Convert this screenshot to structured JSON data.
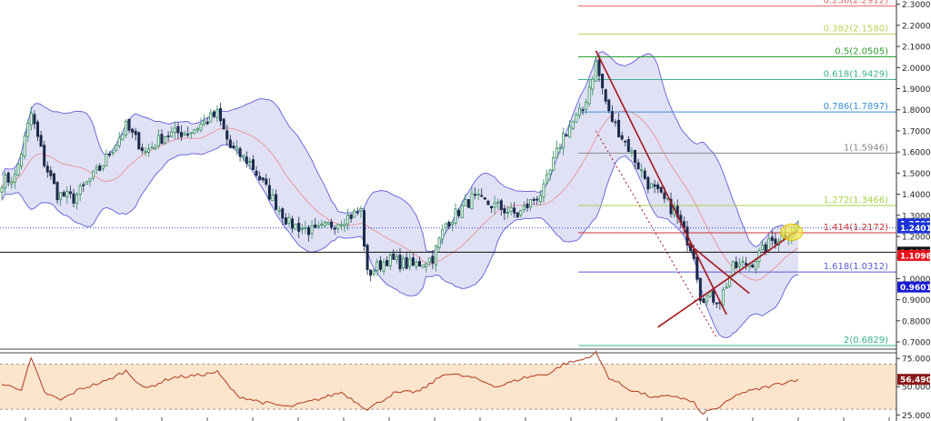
{
  "chart_data": [
    {
      "type": "candlestick",
      "panel": "price",
      "ylim": [
        0.67,
        2.32
      ],
      "y_ticks": [
        "2.3000",
        "2.2000",
        "2.1000",
        "2.0000",
        "1.9000",
        "1.8000",
        "1.7000",
        "1.6000",
        "1.5000",
        "1.4000",
        "1.3000",
        "1.2000",
        "1.1000",
        "1.0000",
        "0.9000",
        "0.8000",
        "0.7000"
      ],
      "price_labels": [
        {
          "text": "1.2595",
          "value": 1.2595,
          "color": "#1a33d6"
        },
        {
          "text": "1.2401",
          "value": 1.2401,
          "color": "#1a33d6"
        },
        {
          "text": "1.1253",
          "value": 1.1253,
          "color": "#111111"
        },
        {
          "text": "1.1098",
          "value": 1.1098,
          "color": "#e8101a"
        },
        {
          "text": "0.9601",
          "value": 0.9601,
          "color": "#1a1ad6"
        }
      ],
      "fibonacci": [
        {
          "label": "0.236(2.2912)",
          "value": 2.2912,
          "color": "#e06666"
        },
        {
          "label": "0.382(2.1580)",
          "value": 2.158,
          "color": "#b7d35a"
        },
        {
          "label": "0.5(2.0505)",
          "value": 2.0505,
          "color": "#2e9e2e"
        },
        {
          "label": "0.618(1.9429)",
          "value": 1.9429,
          "color": "#3cb38a"
        },
        {
          "label": "0.786(1.7897)",
          "value": 1.7897,
          "color": "#3a8fd6"
        },
        {
          "label": "1(1.5946)",
          "value": 1.5946,
          "color": "#888888"
        },
        {
          "label": "1.272(1.3466)",
          "value": 1.3466,
          "color": "#a6d34a"
        },
        {
          "label": "1.414(1.2172)",
          "value": 1.2172,
          "color": "#cc3333"
        },
        {
          "label": "1.618(1.0312)",
          "value": 1.0312,
          "color": "#5a5ad6"
        },
        {
          "label": "2(0.6829)",
          "value": 0.6829,
          "color": "#3cb38a"
        }
      ],
      "horizontal_lines": [
        {
          "value": 1.2401,
          "color": "#3355dd",
          "style": "dotted"
        },
        {
          "value": 1.1253,
          "color": "#111111",
          "style": "solid"
        }
      ],
      "trendlines": [
        {
          "from": [
            182,
            2.08
          ],
          "to": [
            222,
            0.83
          ],
          "color": "#a3151a",
          "style": "solid"
        },
        {
          "from": [
            182,
            1.7
          ],
          "to": [
            219,
            0.72
          ],
          "color": "#a3151a",
          "style": "dotted"
        },
        {
          "from": [
            201,
            0.77
          ],
          "to": [
            244,
            1.23
          ],
          "color": "#a3151a",
          "style": "solid"
        },
        {
          "from": [
            210,
            1.17
          ],
          "to": [
            229,
            0.93
          ],
          "color": "#a3151a",
          "style": "solid"
        }
      ],
      "anchors": [
        {
          "i": 0,
          "v": 1.46
        },
        {
          "i": 4,
          "v": 1.48
        },
        {
          "i": 9,
          "v": 1.78
        },
        {
          "i": 13,
          "v": 1.55
        },
        {
          "i": 17,
          "v": 1.4
        },
        {
          "i": 22,
          "v": 1.38
        },
        {
          "i": 30,
          "v": 1.52
        },
        {
          "i": 38,
          "v": 1.72
        },
        {
          "i": 44,
          "v": 1.6
        },
        {
          "i": 50,
          "v": 1.68
        },
        {
          "i": 58,
          "v": 1.7
        },
        {
          "i": 66,
          "v": 1.78
        },
        {
          "i": 70,
          "v": 1.62
        },
        {
          "i": 76,
          "v": 1.55
        },
        {
          "i": 82,
          "v": 1.4
        },
        {
          "i": 88,
          "v": 1.26
        },
        {
          "i": 96,
          "v": 1.22
        },
        {
          "i": 104,
          "v": 1.28
        },
        {
          "i": 110,
          "v": 1.32
        },
        {
          "i": 112,
          "v": 1.02
        },
        {
          "i": 118,
          "v": 1.09
        },
        {
          "i": 126,
          "v": 1.06
        },
        {
          "i": 132,
          "v": 1.1
        },
        {
          "i": 136,
          "v": 1.26
        },
        {
          "i": 144,
          "v": 1.38
        },
        {
          "i": 152,
          "v": 1.34
        },
        {
          "i": 158,
          "v": 1.3
        },
        {
          "i": 166,
          "v": 1.42
        },
        {
          "i": 172,
          "v": 1.68
        },
        {
          "i": 178,
          "v": 1.8
        },
        {
          "i": 182,
          "v": 2.02
        },
        {
          "i": 186,
          "v": 1.78
        },
        {
          "i": 192,
          "v": 1.62
        },
        {
          "i": 198,
          "v": 1.45
        },
        {
          "i": 206,
          "v": 1.32
        },
        {
          "i": 212,
          "v": 1.12
        },
        {
          "i": 214,
          "v": 0.92
        },
        {
          "i": 220,
          "v": 0.9
        },
        {
          "i": 224,
          "v": 1.05
        },
        {
          "i": 230,
          "v": 1.08
        },
        {
          "i": 236,
          "v": 1.18
        },
        {
          "i": 244,
          "v": 1.24
        }
      ],
      "candle_count": 245,
      "bollinger_period": 20
    },
    {
      "type": "line",
      "panel": "rsi",
      "ylim": [
        22,
        80
      ],
      "y_ticks": [
        "75.0000",
        "50.0000",
        "25.0000"
      ],
      "levels": [
        70,
        30
      ],
      "last_value_label": "56.4903",
      "last_value": 56.4903,
      "anchors": [
        {
          "i": 0,
          "v": 52
        },
        {
          "i": 6,
          "v": 48
        },
        {
          "i": 9,
          "v": 75
        },
        {
          "i": 13,
          "v": 45
        },
        {
          "i": 18,
          "v": 38
        },
        {
          "i": 24,
          "v": 48
        },
        {
          "i": 32,
          "v": 55
        },
        {
          "i": 38,
          "v": 64
        },
        {
          "i": 44,
          "v": 48
        },
        {
          "i": 52,
          "v": 58
        },
        {
          "i": 60,
          "v": 60
        },
        {
          "i": 66,
          "v": 63
        },
        {
          "i": 72,
          "v": 42
        },
        {
          "i": 80,
          "v": 36
        },
        {
          "i": 88,
          "v": 32
        },
        {
          "i": 96,
          "v": 38
        },
        {
          "i": 104,
          "v": 45
        },
        {
          "i": 112,
          "v": 30
        },
        {
          "i": 120,
          "v": 44
        },
        {
          "i": 128,
          "v": 46
        },
        {
          "i": 136,
          "v": 62
        },
        {
          "i": 144,
          "v": 58
        },
        {
          "i": 152,
          "v": 50
        },
        {
          "i": 160,
          "v": 58
        },
        {
          "i": 168,
          "v": 62
        },
        {
          "i": 172,
          "v": 70
        },
        {
          "i": 178,
          "v": 74
        },
        {
          "i": 182,
          "v": 80
        },
        {
          "i": 186,
          "v": 58
        },
        {
          "i": 192,
          "v": 48
        },
        {
          "i": 200,
          "v": 40
        },
        {
          "i": 206,
          "v": 42
        },
        {
          "i": 212,
          "v": 36
        },
        {
          "i": 214,
          "v": 26
        },
        {
          "i": 220,
          "v": 32
        },
        {
          "i": 226,
          "v": 44
        },
        {
          "i": 232,
          "v": 48
        },
        {
          "i": 240,
          "v": 54
        },
        {
          "i": 244,
          "v": 56.49
        }
      ]
    }
  ],
  "colors": {
    "bull": "#2e8b57",
    "bear": "#1a2a4a",
    "band_fill": "#c8c8ee",
    "band_line": "#6b6bdb",
    "ma_line": "#e89a9a",
    "rsi_line": "#b44a2e",
    "rsi_fill": "#fde4cc",
    "highlight": "#f7f04a"
  }
}
